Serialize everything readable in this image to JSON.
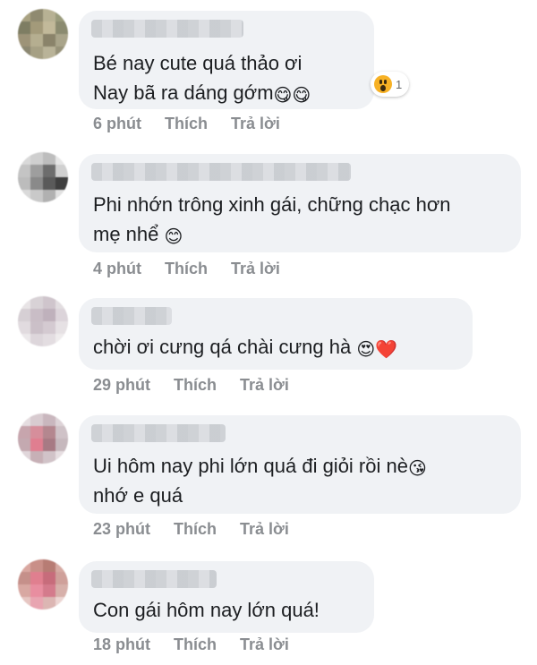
{
  "action_labels": {
    "like": "Thích",
    "reply": "Trả lời"
  },
  "comments": [
    {
      "lines": [
        "Bé nay cute quá thảo ơi",
        "Nay bã ra dáng gớm"
      ],
      "emojis": [
        "😋😋",
        ""
      ],
      "time": "6 phút",
      "reaction": {
        "icon": "wow-reaction-icon",
        "count": "1"
      }
    },
    {
      "lines": [
        "Phi nhớn trông xinh gái, chững chạc hơn",
        "mẹ nhể"
      ],
      "emojis": [
        "",
        "😊"
      ],
      "time": "4 phút"
    },
    {
      "lines": [
        "chời ơi cưng qá chài cưng hà"
      ],
      "emojis": [
        "😍❤️"
      ],
      "time": "29 phút"
    },
    {
      "lines": [
        "Ui hôm nay phi lớn quá đi giỏi rồi nè",
        "nhớ e quá"
      ],
      "emojis": [
        "😘",
        ""
      ],
      "time": "23 phút"
    },
    {
      "lines": [
        "Con gái hôm nay lớn quá!"
      ],
      "emojis": [
        ""
      ],
      "time": "18 phút"
    }
  ]
}
